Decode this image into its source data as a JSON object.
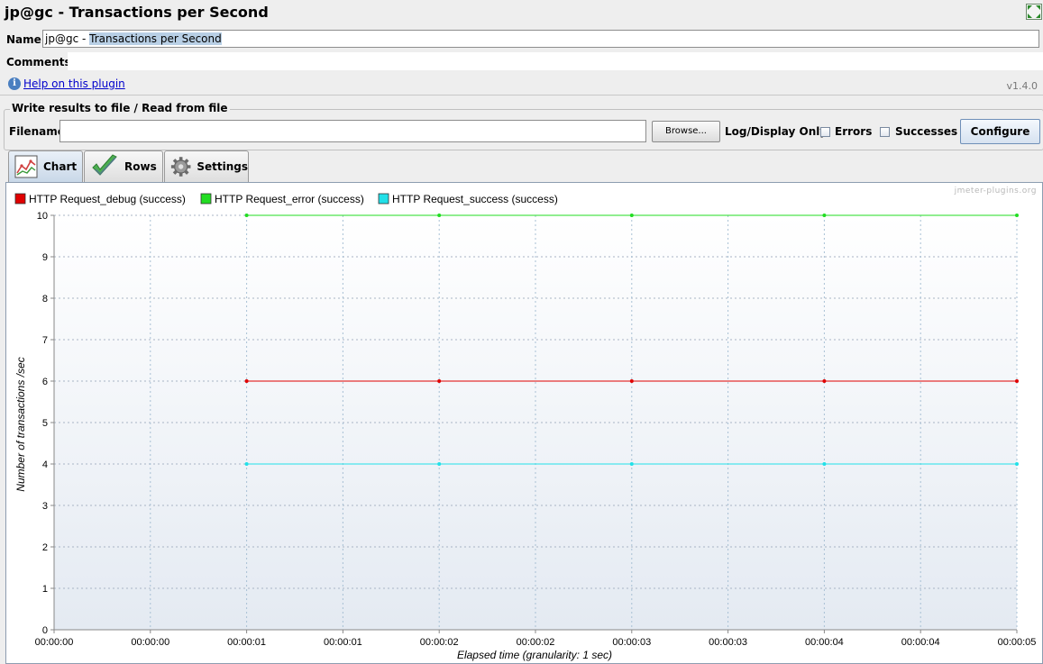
{
  "window": {
    "title": "jp@gc - Transactions per Second"
  },
  "name_field": {
    "label": "Name:",
    "value_prefix": "jp@gc - ",
    "value_selected": "Transactions per Second"
  },
  "comments": {
    "label": "Comments:"
  },
  "help": {
    "icon": "info-icon",
    "link_text": "Help on this plugin",
    "version": "v1.4.0"
  },
  "file_section": {
    "legend": "Write results to file / Read from file",
    "filename_label": "Filename",
    "filename_value": "",
    "browse_label": "Browse...",
    "log_display_label": "Log/Display Only:",
    "errors_label": "Errors",
    "successes_label": "Successes",
    "configure_label": "Configure"
  },
  "tabs": [
    {
      "label": "Chart",
      "icon": "chart-icon",
      "selected": true
    },
    {
      "label": "Rows",
      "icon": "checkmark-icon",
      "selected": false
    },
    {
      "label": "Settings",
      "icon": "gear-icon",
      "selected": false
    }
  ],
  "watermark": "jmeter-plugins.org",
  "chart_data": {
    "type": "line",
    "xlabel": "Elapsed time (granularity: 1 sec)",
    "ylabel": "Number of transactions /sec",
    "ylim": [
      0,
      10
    ],
    "yticks": [
      "0",
      "1",
      "2",
      "3",
      "4",
      "5",
      "6",
      "7",
      "8",
      "9",
      "10"
    ],
    "xlim": [
      0,
      5
    ],
    "xtick_labels": [
      "00:00:00",
      "00:00:00",
      "00:00:01",
      "00:00:01",
      "00:00:02",
      "00:00:02",
      "00:00:03",
      "00:00:03",
      "00:00:04",
      "00:00:04",
      "00:00:05"
    ],
    "grid": true,
    "legend_position": "top-left",
    "x": [
      1,
      2,
      3,
      4,
      5
    ],
    "series": [
      {
        "name": "HTTP Request_debug (success)",
        "color": "#e00000",
        "values": [
          6,
          6,
          6,
          6,
          6
        ]
      },
      {
        "name": "HTTP Request_error (success)",
        "color": "#22dd22",
        "values": [
          10,
          10,
          10,
          10,
          10
        ]
      },
      {
        "name": "HTTP Request_success (success)",
        "color": "#22e0e8",
        "values": [
          4,
          4,
          4,
          4,
          4
        ]
      }
    ]
  }
}
